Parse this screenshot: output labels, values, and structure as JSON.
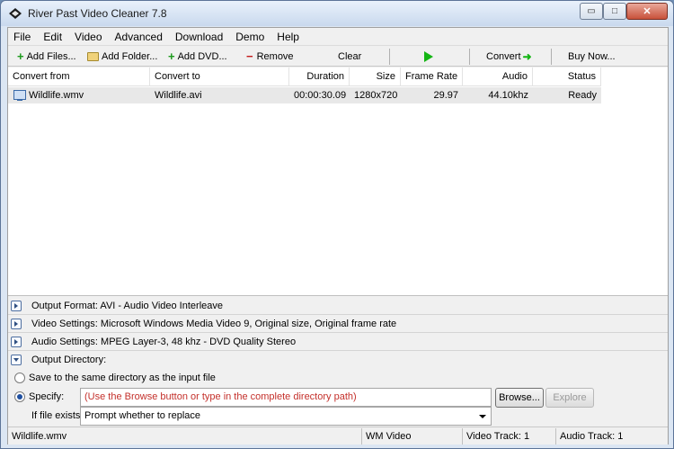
{
  "window": {
    "title": "River Past Video Cleaner 7.8",
    "controls": {
      "minimize": "▭",
      "maximize": "□",
      "close": "✕"
    }
  },
  "menu": [
    "File",
    "Edit",
    "Video",
    "Advanced",
    "Download",
    "Demo",
    "Help"
  ],
  "toolbar": {
    "add_files": "Add Files...",
    "add_folder": "Add Folder...",
    "add_dvd": "Add DVD...",
    "remove": "Remove",
    "clear": "Clear",
    "convert": "Convert",
    "buy_now": "Buy Now...",
    "icons": {
      "add_files": "plus-icon",
      "add_folder": "folder-icon",
      "add_dvd": "plus-icon",
      "remove": "minus-icon",
      "play": "play-icon",
      "convert": "arrow-right-icon"
    }
  },
  "list": {
    "columns": [
      "Convert from",
      "Convert to",
      "Duration",
      "Size",
      "Frame Rate",
      "Audio",
      "Status"
    ],
    "rows": [
      {
        "convert_from": "Wildlife.wmv",
        "convert_to": "Wildlife.avi",
        "duration": "00:00:30.09",
        "size": "1280x720",
        "frame_rate": "29.97",
        "audio": "44.10khz",
        "status": "Ready"
      }
    ]
  },
  "settings": {
    "output_format": "Output Format: AVI - Audio Video Interleave",
    "video_settings": "Video Settings: Microsoft Windows Media Video 9, Original size, Original frame rate",
    "audio_settings": "Audio Settings: MPEG Layer-3, 48 khz - DVD Quality Stereo",
    "output_directory": "Output Directory:",
    "same_dir_label": "Save to the same directory as the input file",
    "specify_label": "Specify:",
    "specify_placeholder": "(Use the Browse button or type in the complete directory path)",
    "browse": "Browse...",
    "explore": "Explore",
    "if_exists_label": "If file exists:",
    "if_exists_value": "Prompt whether to replace",
    "selected_option": "Specify"
  },
  "statusbar": {
    "file": "Wildlife.wmv",
    "format": "WM Video",
    "video_track": "Video Track: 1",
    "audio_track": "Audio Track: 1"
  },
  "colors": {
    "accent_green": "#14b514",
    "placeholder_red": "#c4302b",
    "remove_red": "#c41c1c"
  }
}
